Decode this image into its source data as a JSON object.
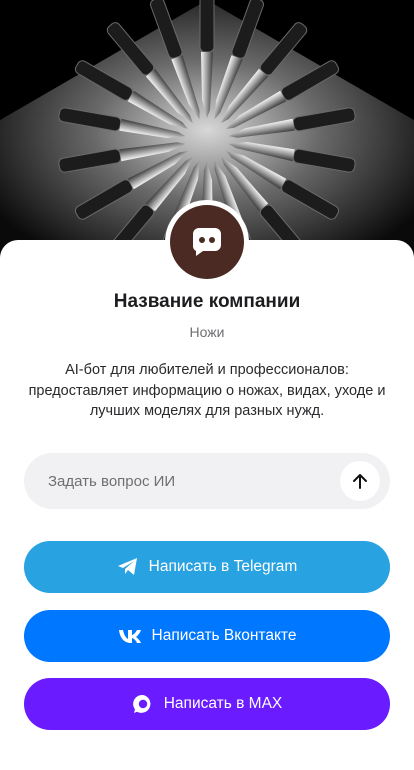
{
  "company": {
    "name": "Название компании",
    "category": "Ножи",
    "description": "AI-бот для любителей и профессионалов: предоставляет информацию о ножах, видах, уходе и лучших моделях для разных нужд."
  },
  "ask": {
    "placeholder": "Задать вопрос ИИ"
  },
  "buttons": {
    "telegram": {
      "label": "Написать в Telegram",
      "color": "#28a2e0",
      "icon": "telegram-icon"
    },
    "vk": {
      "label": "Написать Вконтакте",
      "color": "#0077ff",
      "icon": "vk-icon"
    },
    "max": {
      "label": "Написать в MAX",
      "color": "#6a1bff",
      "icon": "max-icon"
    }
  },
  "colors": {
    "avatar_bg": "#4a2a22",
    "input_bg": "#f1f1f3"
  }
}
